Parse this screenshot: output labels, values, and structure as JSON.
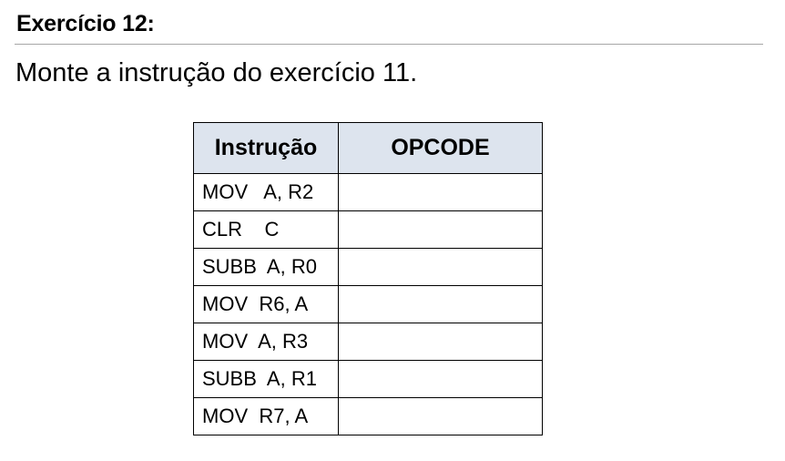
{
  "exercise": {
    "title": "Exercício 12:",
    "statement": "Monte a instrução do exercício 11."
  },
  "table": {
    "headers": [
      "Instrução",
      "OPCODE"
    ],
    "rows": [
      {
        "instrucao": "MOV   A, R2",
        "opcode": ""
      },
      {
        "instrucao": "CLR    C",
        "opcode": ""
      },
      {
        "instrucao": "SUBB  A, R0",
        "opcode": ""
      },
      {
        "instrucao": "MOV  R6, A",
        "opcode": ""
      },
      {
        "instrucao": "MOV  A, R3",
        "opcode": ""
      },
      {
        "instrucao": "SUBB  A, R1",
        "opcode": ""
      },
      {
        "instrucao": "MOV  R7, A",
        "opcode": ""
      }
    ]
  },
  "colors": {
    "header_background": "#dde4ee",
    "rule": "#a6a6a6"
  }
}
